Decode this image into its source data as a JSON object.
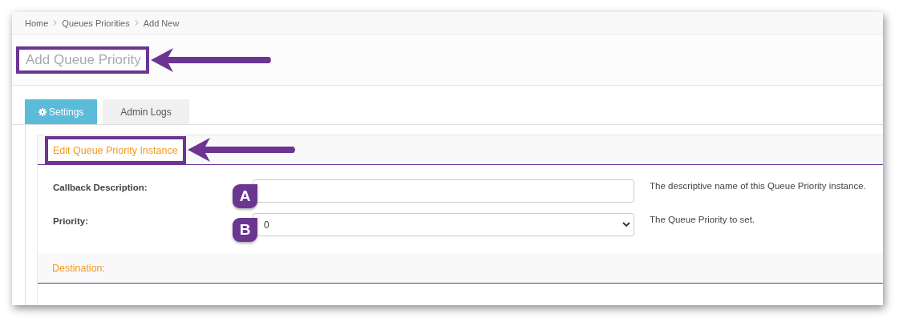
{
  "breadcrumb": [
    {
      "label": "Home"
    },
    {
      "label": "Queues Priorities"
    },
    {
      "label": "Add New"
    }
  ],
  "page_title": "Add Queue Priority",
  "tabs": [
    {
      "label": "Settings",
      "selected": true
    },
    {
      "label": "Admin Logs",
      "selected": false
    }
  ],
  "panel": {
    "title": "Edit Queue Priority Instance",
    "fields": [
      {
        "kind": "text",
        "label": "Callback Description:",
        "help": "The descriptive name of this Queue Priority instance.",
        "badge": "A"
      },
      {
        "kind": "select",
        "label": "Priority:",
        "value": "0",
        "help": "The Queue Priority to set.",
        "badge": "B"
      }
    ]
  },
  "section": {
    "title": "Destination:"
  }
}
